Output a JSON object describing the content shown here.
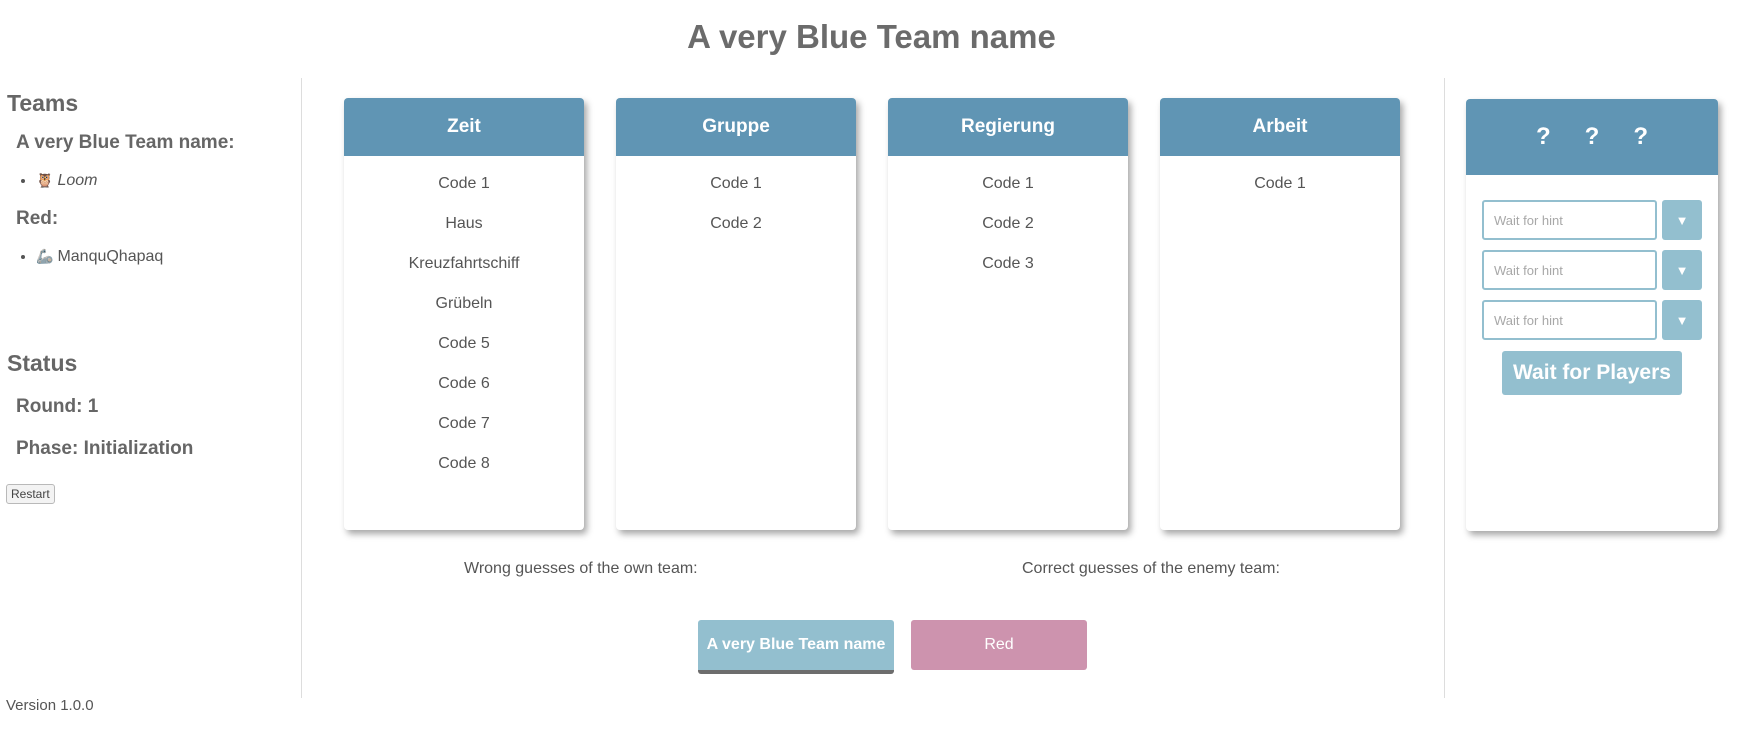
{
  "page": {
    "title": "A very Blue Team name"
  },
  "sidebar": {
    "teams_heading": "Teams",
    "teams": [
      {
        "name": "A very Blue Team name:",
        "players": [
          {
            "icon": "🦉",
            "name": "Loom",
            "italic": true
          }
        ]
      },
      {
        "name": "Red:",
        "players": [
          {
            "icon": "🦾",
            "name": "ManquQhapaq",
            "italic": false
          }
        ]
      }
    ],
    "status_heading": "Status",
    "round": "Round: 1",
    "phase": "Phase: Initialization",
    "restart_label": "Restart",
    "version": "Version 1.0.0"
  },
  "keywords": [
    {
      "title": "Zeit",
      "items": [
        "Code 1",
        "Haus",
        "Kreuzfahrtschiff",
        "Grübeln",
        "Code 5",
        "Code 6",
        "Code 7",
        "Code 8"
      ]
    },
    {
      "title": "Gruppe",
      "items": [
        "Code 1",
        "Code 2"
      ]
    },
    {
      "title": "Regierung",
      "items": [
        "Code 1",
        "Code 2",
        "Code 3"
      ]
    },
    {
      "title": "Arbeit",
      "items": [
        "Code 1"
      ]
    }
  ],
  "guesses": {
    "wrong_own": "Wrong guesses of the own team:",
    "correct_enemy": "Correct guesses of the enemy team:"
  },
  "team_buttons": {
    "blue": "A very Blue Team name",
    "red": "Red"
  },
  "hint_panel": {
    "code": [
      "?",
      "?",
      "?"
    ],
    "placeholder": "Wait for hint",
    "dropdown_icon": "▼",
    "wait_label": "Wait for Players"
  },
  "colors": {
    "header_blue": "#6095b4",
    "light_blue": "#93bfcf",
    "pink": "#cd93ae"
  }
}
